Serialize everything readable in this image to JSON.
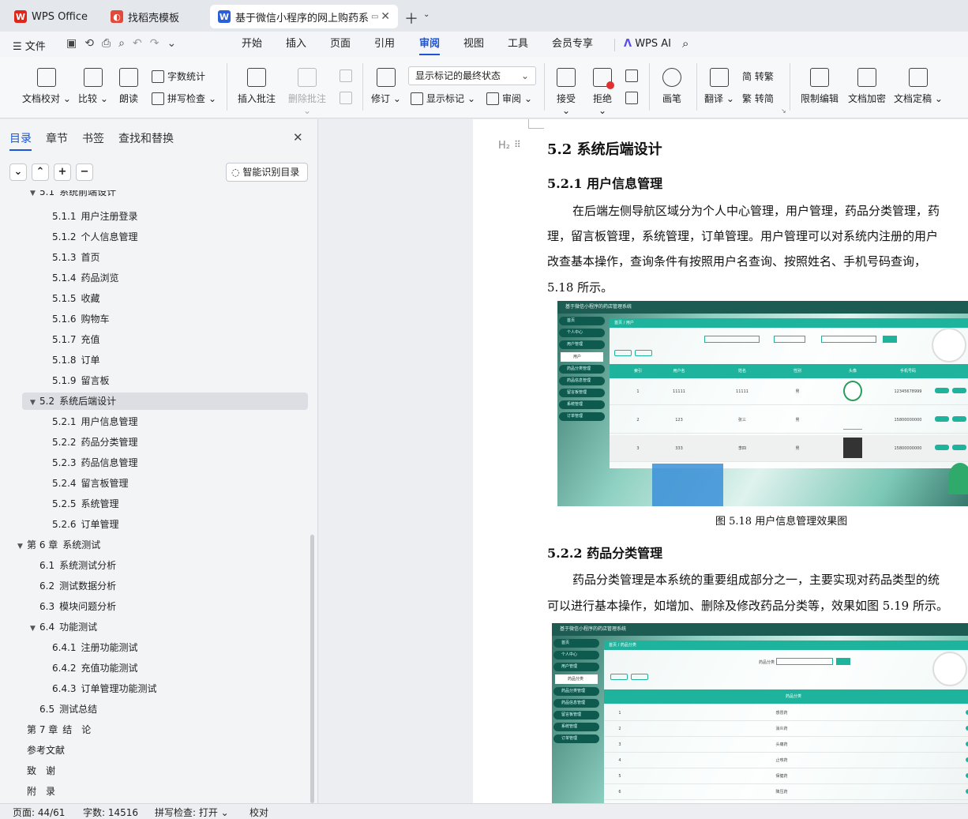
{
  "tabs": [
    {
      "label": "WPS Office"
    },
    {
      "label": "找稻壳模板"
    },
    {
      "label": "基于微信小程序的网上购药系"
    }
  ],
  "menubar": {
    "file": "文件",
    "items": [
      "开始",
      "插入",
      "页面",
      "引用",
      "审阅",
      "视图",
      "工具",
      "会员专享"
    ],
    "active": "审阅",
    "ai": "WPS AI"
  },
  "ribbon": {
    "doc_check": "文档校对",
    "compare": "比较",
    "read_aloud": "朗读",
    "word_count": "字数统计",
    "spell_check": "拼写检查",
    "insert_comment": "插入批注",
    "delete_comment": "删除批注",
    "revise": "修订",
    "markup_state": "显示标记的最终状态",
    "show_markup": "显示标记",
    "review": "审阅",
    "accept": "接受",
    "reject": "拒绝",
    "pen": "画笔",
    "translate": "翻译",
    "to_traditional": "简 转繁",
    "to_simplified": "繁 转简",
    "restrict_edit": "限制编辑",
    "encrypt": "文档加密",
    "finalize": "文档定稿"
  },
  "sidebar": {
    "tabs": [
      "目录",
      "章节",
      "书签",
      "查找和替换"
    ],
    "smart_btn": "智能识别目录",
    "toc": [
      {
        "num": "5.1",
        "text": "系统前端设计",
        "level": 2,
        "collapsible": true
      },
      {
        "num": "5.1.1",
        "text": "用户注册登录",
        "level": 3
      },
      {
        "num": "5.1.2",
        "text": "个人信息管理",
        "level": 3
      },
      {
        "num": "5.1.3",
        "text": "首页",
        "level": 3
      },
      {
        "num": "5.1.4",
        "text": "药品浏览",
        "level": 3
      },
      {
        "num": "5.1.5",
        "text": "收藏",
        "level": 3
      },
      {
        "num": "5.1.6",
        "text": "购物车",
        "level": 3
      },
      {
        "num": "5.1.7",
        "text": "充值",
        "level": 3
      },
      {
        "num": "5.1.8",
        "text": "订单",
        "level": 3
      },
      {
        "num": "5.1.9",
        "text": "留言板",
        "level": 3
      },
      {
        "num": "5.2",
        "text": "系统后端设计",
        "level": 2,
        "collapsible": true,
        "selected": true
      },
      {
        "num": "5.2.1",
        "text": "用户信息管理",
        "level": 3
      },
      {
        "num": "5.2.2",
        "text": "药品分类管理",
        "level": 3
      },
      {
        "num": "5.2.3",
        "text": "药品信息管理",
        "level": 3
      },
      {
        "num": "5.2.4",
        "text": "留言板管理",
        "level": 3
      },
      {
        "num": "5.2.5",
        "text": "系统管理",
        "level": 3
      },
      {
        "num": "5.2.6",
        "text": "订单管理",
        "level": 3
      },
      {
        "num": "第 6 章",
        "text": "系统测试",
        "level": 1,
        "collapsible": true
      },
      {
        "num": "6.1",
        "text": "系统测试分析",
        "level": 2
      },
      {
        "num": "6.2",
        "text": "测试数据分析",
        "level": 2
      },
      {
        "num": "6.3",
        "text": "模块问题分析",
        "level": 2
      },
      {
        "num": "6.4",
        "text": "功能测试",
        "level": 2,
        "collapsible": true
      },
      {
        "num": "6.4.1",
        "text": "注册功能测试",
        "level": 3
      },
      {
        "num": "6.4.2",
        "text": "充值功能测试",
        "level": 3
      },
      {
        "num": "6.4.3",
        "text": "订单管理功能测试",
        "level": 3
      },
      {
        "num": "6.5",
        "text": "测试总结",
        "level": 2
      },
      {
        "num": "第 7 章",
        "text": "结　论",
        "level": 1
      },
      {
        "num": "",
        "text": "参考文献",
        "level": 1
      },
      {
        "num": "",
        "text": "致　谢",
        "level": 1
      },
      {
        "num": "",
        "text": "附　录",
        "level": 1
      }
    ]
  },
  "document": {
    "h_marker": "H₂",
    "section_title": "5.2  系统后端设计",
    "sub1_title": "5.2.1  用户信息管理",
    "para1": [
      "在后端左侧导航区域分为个人中心管理，用户管理，药品分类管理，药",
      "理，留言板管理，系统管理，订单管理。用户管理可以对系统内注册的用户",
      "改查基本操作，查询条件有按照用户名查询、按照姓名、手机号码查询，",
      "5.18 所示。"
    ],
    "caption1": "图 5.18  用户信息管理效果图",
    "sub2_title": "5.2.2  药品分类管理",
    "para2": [
      "药品分类管理是本系统的重要组成部分之一，主要实现对药品类型的统",
      "可以进行基本操作，如增加、删除及修改药品分类等，效果如图 5.19 所示。"
    ],
    "shot1": {
      "title": "基于微信小程序的药店管理系统",
      "nav": [
        "首页",
        "个人中心",
        "用户管理",
        "药品分类管理",
        "药品信息管理",
        "留言板管理",
        "系统管理",
        "订单管理"
      ],
      "sub_item": "用户",
      "crumb": "首页 / 用户",
      "headers": [
        "索引",
        "用户名",
        "姓名",
        "性别",
        "头像",
        "手机号码"
      ],
      "rows": [
        [
          "1",
          "11111",
          "11111",
          "男",
          "",
          "12345678999"
        ],
        [
          "2",
          "123",
          "张三",
          "男",
          "",
          "15800000000"
        ],
        [
          "3",
          "333",
          "李四",
          "男",
          "",
          "15800000000"
        ]
      ]
    },
    "shot2": {
      "title": "基于微信小程序的药店管理系统",
      "nav": [
        "首页",
        "个人中心",
        "用户管理",
        "药品分类管理",
        "药品信息管理",
        "留言板管理",
        "系统管理",
        "订单管理"
      ],
      "sub_item": "药品分类",
      "crumb": "首页 / 药品分类",
      "search_label": "药品分类",
      "header": "药品分类",
      "rows": [
        "感冒药",
        "消炎药",
        "头痛药",
        "止咳药",
        "保健药",
        "降压药"
      ]
    }
  },
  "status": {
    "page": "页面: 44/61",
    "words": "字数: 14516",
    "spell": "拼写检查: 打开",
    "proof": "校对"
  }
}
